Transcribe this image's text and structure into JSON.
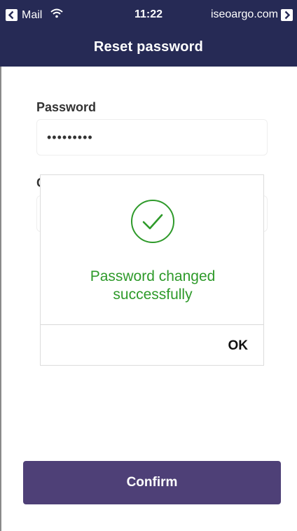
{
  "status_bar": {
    "back_app": "Mail",
    "time": "11:22",
    "url": "iseoargo.com"
  },
  "header": {
    "title": "Reset password"
  },
  "form": {
    "password_label": "Password",
    "password_value": "•••••••••",
    "confirm_label_partial": "C"
  },
  "dialog": {
    "message": "Password changed successfully",
    "ok_label": "OK",
    "icon": "check-circle-icon",
    "accent_color": "#2e9a2a"
  },
  "footer": {
    "confirm_label": "Confirm",
    "button_color": "#4e4077"
  },
  "colors": {
    "header_bg": "#262a55"
  }
}
